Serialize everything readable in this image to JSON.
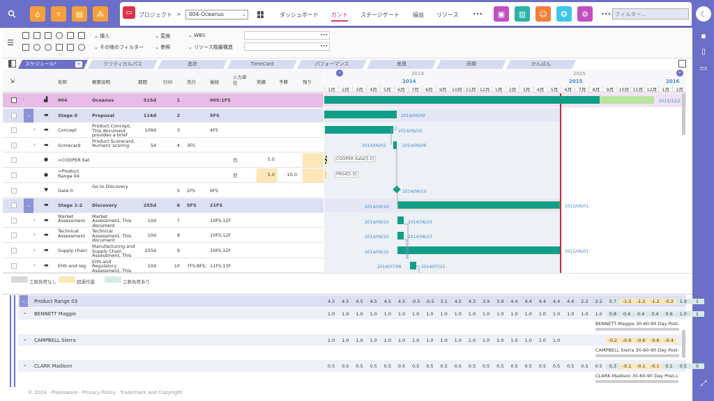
{
  "toolbar": {
    "project_label": "プロジェクト",
    "project_chevron": ">",
    "project_select": "004-Oceanus",
    "menu": [
      "ダッシュボード",
      "ガント",
      "ステージゲート",
      "損益",
      "リソース"
    ],
    "more": "•••",
    "more2": "•••",
    "filter_placeholder": "フィルター..."
  },
  "ribbon": {
    "insert": "挿入",
    "other_filter": "その他のフィルター",
    "transform": "変換",
    "reference": "参照",
    "wbs": "WBS",
    "resource_structure": "リソース階層構造"
  },
  "tabs": [
    "スケジュール*",
    "クリティカルパス",
    "進捗",
    "TimeCard",
    "パフォーマンス",
    "差異",
    "同期",
    "かんばん"
  ],
  "columns": [
    "名称",
    "概要説明",
    "期間",
    "行ID",
    "先行",
    "後続",
    "入力単位",
    "実績",
    "予算",
    "残り"
  ],
  "timeline": {
    "years_top": [
      "2014",
      "2015"
    ],
    "years_bottom": [
      "2014",
      "2015",
      "2016"
    ],
    "months": [
      "1月",
      "2月",
      "3月",
      "4月",
      "5月",
      "6月",
      "7月",
      "8月",
      "9月",
      "10月",
      "11月",
      "12月",
      "1月",
      "2月",
      "3月",
      "4月",
      "5月",
      "6月",
      "7月",
      "8月",
      "9月",
      "10月",
      "11月",
      "12月",
      "1月",
      "2月"
    ]
  },
  "rows": [
    {
      "name": "004",
      "desc": "Oceanus",
      "dur": "515d",
      "id": "1",
      "pred": "",
      "succ": "005:1FS",
      "unit": "",
      "actual": "",
      "budget": "",
      "remain": ""
    },
    {
      "name": "Stage 0",
      "desc": "Proposal",
      "dur": "114d",
      "id": "2",
      "pred": "",
      "succ": "5FS",
      "unit": "",
      "actual": "",
      "budget": "",
      "remain": ""
    },
    {
      "name": "Concept",
      "desc": "Product Concept, This document provides a brief",
      "dur": "109d",
      "id": "3",
      "pred": "",
      "succ": "4FS",
      "unit": "",
      "actual": "",
      "budget": "",
      "remain": ""
    },
    {
      "name": "Scorecard",
      "desc": "Product Scorecard, Numeric scoring",
      "dur": "5d",
      "id": "4",
      "pred": "3FS",
      "succ": "",
      "unit": "",
      "actual": "",
      "budget": "",
      "remain": ""
    },
    {
      "name": ">COOPER Kate",
      "desc": "",
      "dur": "",
      "id": "",
      "pred": "",
      "succ": "",
      "unit": "日",
      "actual": "5.0",
      "budget": "",
      "remain": ""
    },
    {
      "name": ">Product Range 04",
      "desc": "",
      "dur": "",
      "id": "",
      "pred": "",
      "succ": "",
      "unit": "日",
      "actual": "5.0",
      "budget": "10.0",
      "remain": ""
    },
    {
      "name": "Gate 0",
      "desc": "Go to Discovery",
      "dur": "",
      "id": "5",
      "pred": "2FS",
      "succ": "6FS",
      "unit": "",
      "actual": "",
      "budget": "",
      "remain": ""
    },
    {
      "name": "Stage 1-2",
      "desc": "Discovery",
      "dur": "255d",
      "id": "6",
      "pred": "5FS",
      "succ": "21FS",
      "unit": "",
      "actual": "",
      "budget": "",
      "remain": ""
    },
    {
      "name": "Market Assessment",
      "desc": "Market Assessment, This document",
      "dur": "10d",
      "id": "7",
      "pred": "",
      "succ": "10FS;12F",
      "unit": "",
      "actual": "",
      "budget": "",
      "remain": ""
    },
    {
      "name": "Technical Assessment",
      "desc": "Technical Assessment, This document",
      "dur": "10d",
      "id": "8",
      "pred": "",
      "succ": "10FS;12F",
      "unit": "",
      "actual": "",
      "budget": "",
      "remain": ""
    },
    {
      "name": "Supply chain",
      "desc": "Manufacturing and Supply Chain Assessment, This",
      "dur": "255d",
      "id": "9",
      "pred": "",
      "succ": "10FS;12F",
      "unit": "",
      "actual": "",
      "budget": "",
      "remain": ""
    },
    {
      "name": "EHS and reg",
      "desc": "EHS and Regulatory Assessment, This",
      "dur": "10d",
      "id": "10",
      "pred": "7FS;8FS;",
      "succ": "11FS;13F",
      "unit": "",
      "actual": "",
      "budget": "",
      "remain": ""
    }
  ],
  "gantt_labels": {
    "r0_end": "2015/12/2",
    "r1_end": "2014/06/09",
    "r2_end": "2014/06/02",
    "r3_start": "2014/06/03",
    "r3_end": "2014/06/09",
    "r4": "COOPER Kate[5.0]",
    "r5": "PR04[5.0]",
    "r6_end": "2014/06/10",
    "r7_start": "2014/06/10",
    "r7_end": "2015/06/01",
    "r8_start": "2014/06/10",
    "r8_end": "2014/06/23",
    "r9_start": "2014/06/10",
    "r9_end": "2014/06/23",
    "r10_start": "2014/06/10",
    "r10_end": "2015/06/01",
    "r11_start": "2014/07/08",
    "r11_end": "2014/07/21"
  },
  "legend": [
    "工数負荷なし",
    "超過作業",
    "工数負荷あり"
  ],
  "resources": {
    "group": "Product Range 03",
    "group_values": [
      "4.5",
      "4.5",
      "4.5",
      "4.5",
      "4.5",
      "4.5",
      "-0.5",
      "-0.5",
      "3.1",
      "4.5",
      "4.3",
      "3.9",
      "3.9",
      "4.4",
      "4.4",
      "4.4",
      "4.4",
      "4.4",
      "2.2",
      "2.2",
      "0.7",
      "-1.2",
      "-1.2",
      "-1.2",
      "-0.2",
      "1.9",
      "1"
    ],
    "people": [
      {
        "name": "BENNETT Maggie",
        "values": [
          "1.0",
          "1.0",
          "1.0",
          "1.0",
          "1.0",
          "1.0",
          "1.0",
          "1.0",
          "1.0",
          "1.0",
          "1.0",
          "1.0",
          "1.0",
          "1.0",
          "1.0",
          "1.0",
          "1.0",
          "1.0",
          "1.0",
          "1.0",
          "0.8",
          "0.4",
          "0.4",
          "0.4",
          "0.6",
          "1.0",
          "1"
        ],
        "tag": "BENNETT Maggie 30-60-90 Day Post-"
      },
      {
        "name": "CAMPBELL Sierra",
        "values": [
          "1.0",
          "1.0",
          "1.0",
          "1.0",
          "1.0",
          "1.0",
          "1.0",
          "1.0",
          "1.0",
          "1.0",
          "1.0",
          "1.0",
          "1.0",
          "1.0",
          "1.0",
          "1.0",
          "1.0",
          "",
          "",
          "",
          "-0.2",
          "-0.6",
          "-0.6",
          "-0.6",
          "-0.4",
          "",
          ""
        ],
        "tag": "CAMPBELL Sierra 30-60-90 Day Post-"
      },
      {
        "name": "CLARK Madison",
        "values": [
          "0.5",
          "0.5",
          "0.5",
          "0.5",
          "0.5",
          "0.5",
          "0.5",
          "0.5",
          "0.5",
          "0.5",
          "0.5",
          "0.5",
          "0.5",
          "0.5",
          "0.5",
          "0.5",
          "0.5",
          "0.5",
          "0.5",
          "0.5",
          "0.3",
          "-0.1",
          "-0.1",
          "-0.1",
          "0.1",
          "0.5",
          "0"
        ],
        "tag": "CLARK Madison 30-60-90 Day Post-L"
      }
    ]
  },
  "footer": "© 2024 · Planisware · Privacy Policy · Trademark and Copyright",
  "colors": {
    "accent": "#6b6fc7",
    "bar": "#119e88",
    "today": "#d0282e"
  }
}
